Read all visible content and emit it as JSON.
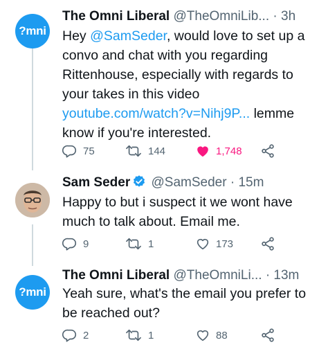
{
  "tweets": [
    {
      "avatar_text": "?mni",
      "name": "The Omni Liberal",
      "handle": "@TheOmniLib...",
      "time": "3h",
      "body": {
        "t1": "Hey ",
        "mention": "@SamSeder",
        "t2": ", would love to set up a convo and chat with you regarding Rittenhouse, especially with regards to your takes in this video ",
        "link": "youtube.com/watch?v=Nihj9P...",
        "t3": " lemme know if you're interested."
      },
      "replies": "75",
      "retweets": "144",
      "likes": "1,748",
      "liked": true
    },
    {
      "name": "Sam Seder",
      "handle": "@SamSeder",
      "time": "15m",
      "verified": true,
      "body": {
        "t1": "Happy to but i suspect it we wont have much to talk about. Email me."
      },
      "replies": "9",
      "retweets": "1",
      "likes": "173"
    },
    {
      "avatar_text": "?mni",
      "name": "The Omni Liberal",
      "handle": "@TheOmniLi...",
      "time": "13m",
      "body": {
        "t1": "Yeah sure, what's the email you prefer to be reached out?"
      },
      "replies": "2",
      "retweets": "1",
      "likes": "88"
    }
  ],
  "colors": {
    "accent": "#1d9bf0",
    "like": "#f91880",
    "muted": "#536471",
    "text": "#0f1419"
  },
  "icons": [
    "reply-icon",
    "retweet-icon",
    "like-icon",
    "share-icon",
    "verified-badge-icon"
  ]
}
